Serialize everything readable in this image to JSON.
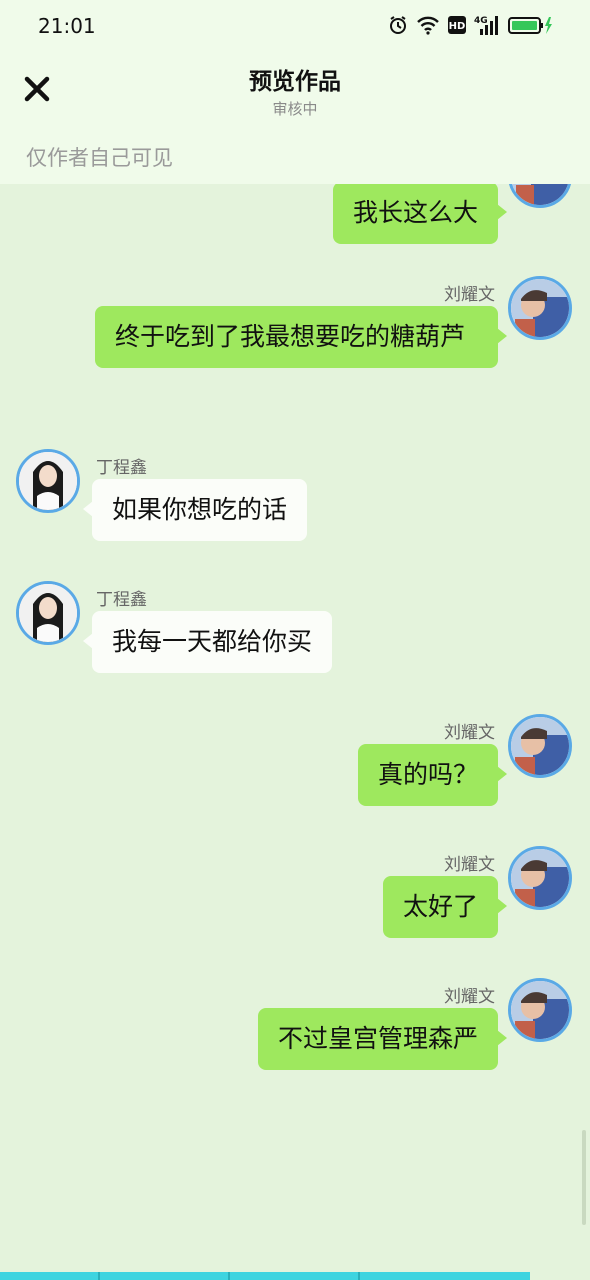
{
  "status_bar": {
    "time": "21:01",
    "icons": [
      "alarm-icon",
      "wifi-icon",
      "hd-icon",
      "4g-signal-icon",
      "battery-charging-icon"
    ],
    "hd_label": "HD",
    "network_label": "4G"
  },
  "header": {
    "close_icon": "close-icon",
    "title": "预览作品",
    "subtitle": "审核中",
    "visibility_note": "仅作者自己可见"
  },
  "colors": {
    "background": "#e4f3dc",
    "header_bg": "#f0fbea",
    "bubble_right": "#9ee85e",
    "bubble_left": "#fbfdf9",
    "avatar_border": "#5aa9e6"
  },
  "messages": [
    {
      "side": "right",
      "name": "",
      "text": "我长这么大"
    },
    {
      "side": "right",
      "name": "刘耀文",
      "text": "终于吃到了我最想要吃的糖葫芦"
    },
    {
      "side": "left",
      "name": "丁程鑫",
      "text": "如果你想吃的话"
    },
    {
      "side": "left",
      "name": "丁程鑫",
      "text": "我每一天都给你买"
    },
    {
      "side": "right",
      "name": "刘耀文",
      "text": "真的吗？"
    },
    {
      "side": "right",
      "name": "刘耀文",
      "text": "太好了"
    },
    {
      "side": "right",
      "name": "刘耀文",
      "text": "不过皇宫管理森严"
    }
  ]
}
